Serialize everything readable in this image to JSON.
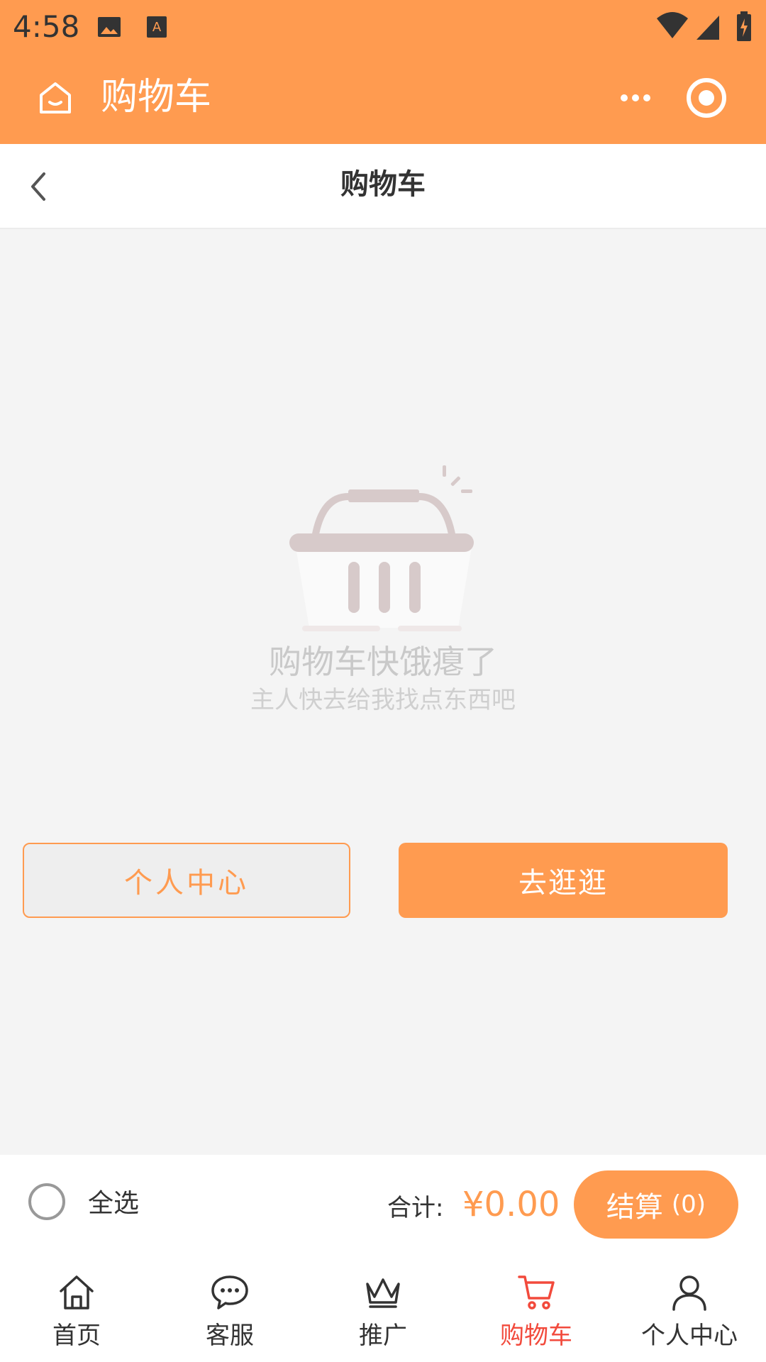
{
  "status_bar": {
    "time": "4:58"
  },
  "app_bar": {
    "title": "购物车"
  },
  "page_header": {
    "title": "购物车"
  },
  "empty_state": {
    "title": "购物车快饿瘪了",
    "subtitle": "主人快去给我找点东西吧"
  },
  "actions": {
    "profile_label": "个人中心",
    "shop_label": "去逛逛"
  },
  "checkout": {
    "select_all_label": "全选",
    "total_label": "合计:",
    "total_amount": "¥0.00",
    "button_label": "结算",
    "button_count": "(0)"
  },
  "bottom_nav": {
    "items": [
      {
        "label": "首页",
        "icon": "home-icon",
        "active": false
      },
      {
        "label": "客服",
        "icon": "chat-icon",
        "active": false
      },
      {
        "label": "推广",
        "icon": "crown-icon",
        "active": false
      },
      {
        "label": "购物车",
        "icon": "cart-icon",
        "active": true
      },
      {
        "label": "个人中心",
        "icon": "user-icon",
        "active": false
      }
    ]
  },
  "colors": {
    "accent": "#ff9b50",
    "active_nav": "#f24a3c",
    "background": "#f4f4f4"
  }
}
